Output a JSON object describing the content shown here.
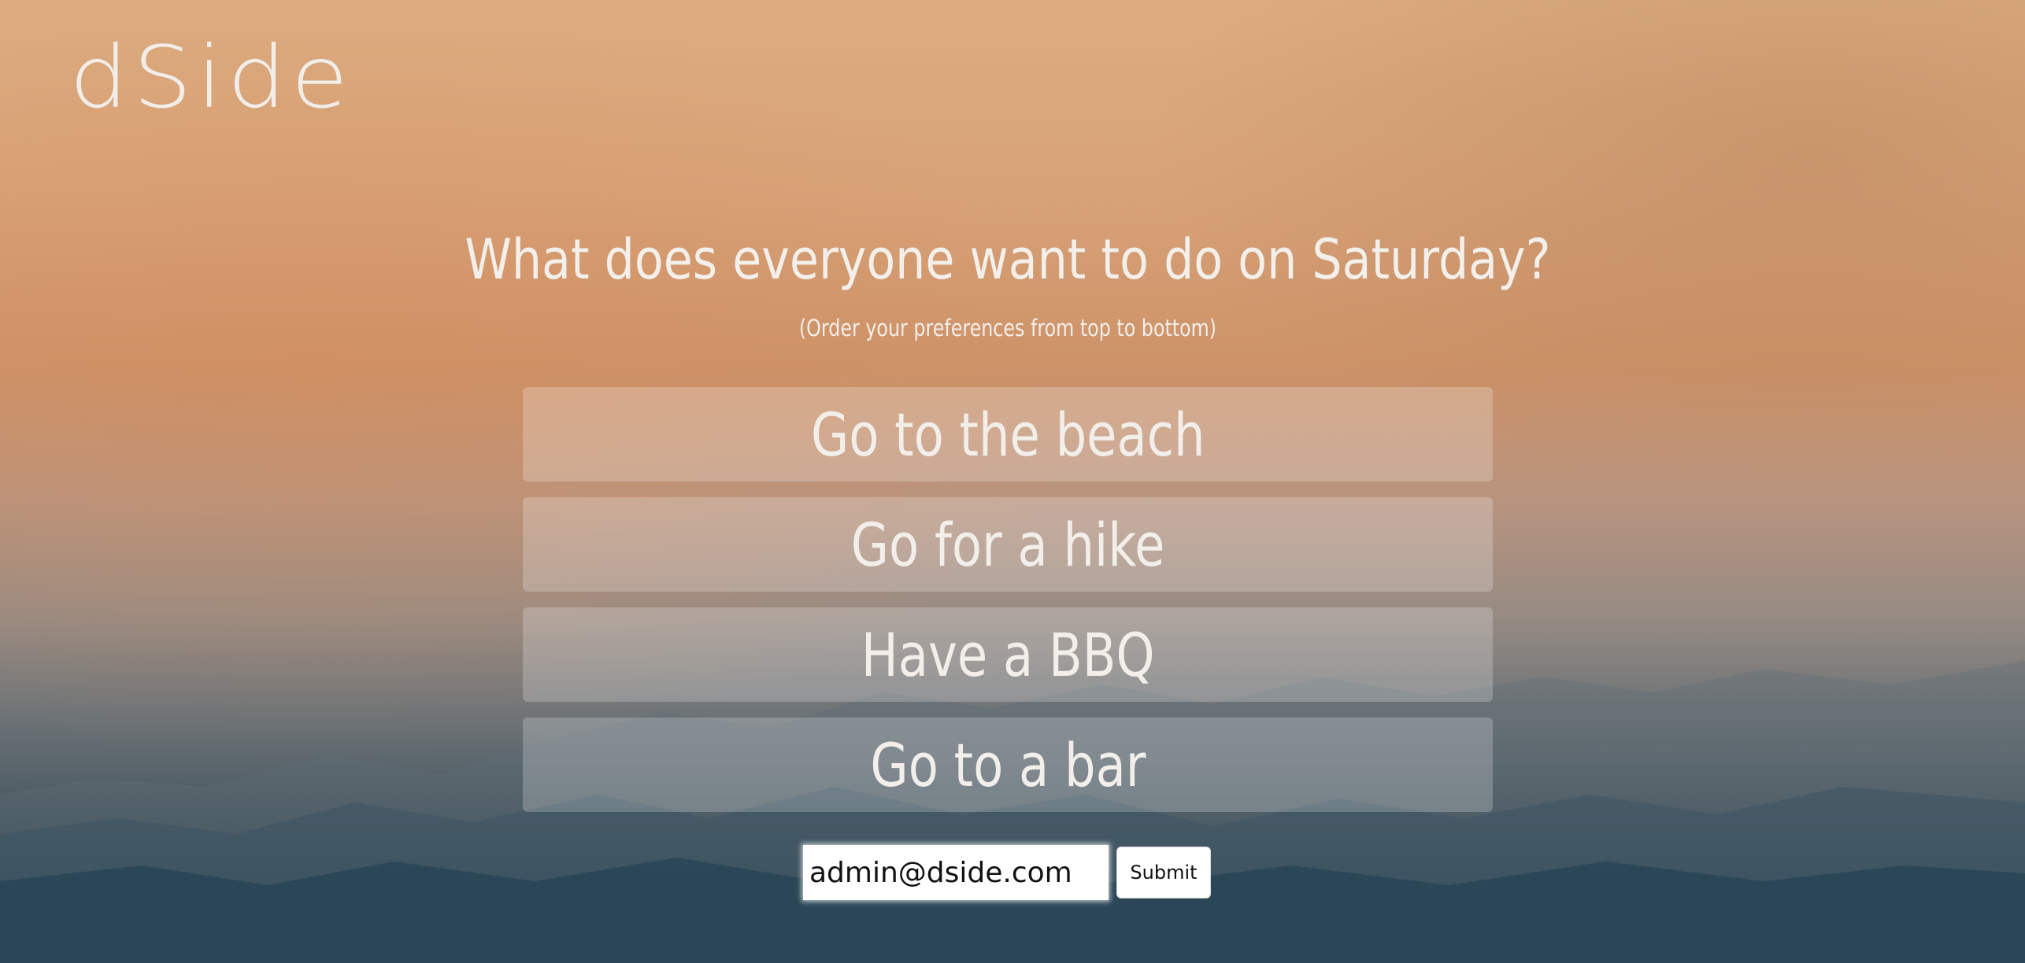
{
  "brand": {
    "logo_text": "dSide"
  },
  "poll": {
    "question": "What does everyone want to do on Saturday?",
    "instructions": "(Order your preferences from top to bottom)",
    "options": [
      {
        "label": "Go to the beach"
      },
      {
        "label": "Go for a hike"
      },
      {
        "label": "Have a BBQ"
      },
      {
        "label": "Go to a bar"
      }
    ]
  },
  "form": {
    "email_value": "admin@dside.com",
    "submit_label": "Submit"
  },
  "colors": {
    "sky_top": "#dcac80",
    "sky_mid": "#cd9268",
    "valley_bottom": "#223c4d",
    "text_light": "#f3efeb"
  }
}
